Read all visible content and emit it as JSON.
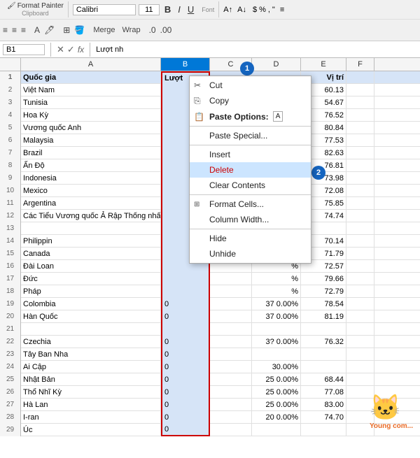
{
  "toolbar": {
    "format_painter_label": "Format Painter",
    "clipboard_label": "Clipboard",
    "font_label": "Font",
    "font_name": "Calibri",
    "font_size": "11",
    "bold": "B",
    "italic": "I",
    "underline": "U"
  },
  "formula_bar": {
    "name_box": "B1",
    "content": "Lượt nh"
  },
  "columns": {
    "a": "A",
    "b": "B",
    "c": "C",
    "d": "D",
    "e": "E",
    "f": "F"
  },
  "context_menu": {
    "cut": "Cut",
    "copy": "Copy",
    "paste_options": "Paste Options:",
    "paste_special": "Paste Special...",
    "insert": "Insert",
    "delete": "Delete",
    "clear_contents": "Clear Contents",
    "format_cells": "Format Cells...",
    "column_width": "Column Width...",
    "hide": "Hide",
    "unhide": "Unhide"
  },
  "rows": [
    {
      "num": "1",
      "a": "Quốc gia",
      "b": "Lượt",
      "c": "",
      "d": "",
      "e": "Vị trí",
      "f": ""
    },
    {
      "num": "2",
      "a": "Việt Nam",
      "b": "",
      "c": "",
      "d": "%",
      "e": "60.13",
      "f": ""
    },
    {
      "num": "3",
      "a": "Tunisia",
      "b": "",
      "c": "",
      "d": "%",
      "e": "54.67",
      "f": ""
    },
    {
      "num": "4",
      "a": "Hoa Kỳ",
      "b": "",
      "c": "",
      "d": "%",
      "e": "76.52",
      "f": ""
    },
    {
      "num": "5",
      "a": "Vương quốc Anh",
      "b": "",
      "c": "",
      "d": "%",
      "e": "80.84",
      "f": ""
    },
    {
      "num": "6",
      "a": "Malaysia",
      "b": "",
      "c": "",
      "d": "%",
      "e": "77.53",
      "f": ""
    },
    {
      "num": "7",
      "a": "Brazil",
      "b": "",
      "c": "",
      "d": "%",
      "e": "82.63",
      "f": ""
    },
    {
      "num": "8",
      "a": "Ấn Độ",
      "b": "",
      "c": "",
      "d": "%",
      "e": "76.81",
      "f": ""
    },
    {
      "num": "9",
      "a": "Indonesia",
      "b": "",
      "c": "",
      "d": "%",
      "e": "73.98",
      "f": ""
    },
    {
      "num": "10",
      "a": "Mexico",
      "b": "",
      "c": "",
      "d": "%",
      "e": "72.08",
      "f": ""
    },
    {
      "num": "11",
      "a": "Argentina",
      "b": "",
      "c": "",
      "d": "%",
      "e": "75.85",
      "f": ""
    },
    {
      "num": "12",
      "a": "Các Tiểu Vương quốc Ả Rập Thống nhất",
      "b": "",
      "c": "",
      "d": "%",
      "e": "74.74",
      "f": ""
    },
    {
      "num": "13",
      "a": "",
      "b": "",
      "c": "",
      "d": "",
      "e": "",
      "f": ""
    },
    {
      "num": "14",
      "a": "Philippin",
      "b": "",
      "c": "",
      "d": "%",
      "e": "70.14",
      "f": ""
    },
    {
      "num": "15",
      "a": "Canada",
      "b": "",
      "c": "",
      "d": "%",
      "e": "71.79",
      "f": ""
    },
    {
      "num": "16",
      "a": "Đài Loan",
      "b": "",
      "c": "",
      "d": "%",
      "e": "72.57",
      "f": ""
    },
    {
      "num": "17",
      "a": "Đức",
      "b": "",
      "c": "",
      "d": "%",
      "e": "79.66",
      "f": ""
    },
    {
      "num": "18",
      "a": "Pháp",
      "b": "",
      "c": "",
      "d": "%",
      "e": "72.79",
      "f": ""
    },
    {
      "num": "19",
      "a": "Colombia",
      "b": "0",
      "c": "",
      "d": "37  0.00%",
      "e": "78.54",
      "f": ""
    },
    {
      "num": "20",
      "a": "Hàn Quốc",
      "b": "0",
      "c": "",
      "d": "37  0.00%",
      "e": "81.19",
      "f": ""
    },
    {
      "num": "21",
      "a": "",
      "b": "",
      "c": "",
      "d": "",
      "e": "",
      "f": ""
    },
    {
      "num": "22",
      "a": "Czechia",
      "b": "0",
      "c": "",
      "d": "3?  0.00%",
      "e": "76.32",
      "f": ""
    },
    {
      "num": "23",
      "a": "Tây Ban Nha",
      "b": "0",
      "c": "",
      "d": "",
      "e": "",
      "f": ""
    },
    {
      "num": "24",
      "a": "Ai Cập",
      "b": "0",
      "c": "",
      "d": "30.00%",
      "e": "",
      "f": ""
    },
    {
      "num": "25",
      "a": "Nhật Bản",
      "b": "0",
      "c": "",
      "d": "25  0.00%",
      "e": "68.44",
      "f": ""
    },
    {
      "num": "26",
      "a": "Thổ Nhĩ Kỳ",
      "b": "0",
      "c": "",
      "d": "25  0.00%",
      "e": "77.08",
      "f": ""
    },
    {
      "num": "27",
      "a": "Hà Lan",
      "b": "0",
      "c": "",
      "d": "25  0.00%",
      "e": "83.00",
      "f": ""
    },
    {
      "num": "28",
      "a": "I-ran",
      "b": "0",
      "c": "",
      "d": "20  0.00%",
      "e": "74.70",
      "f": ""
    },
    {
      "num": "29",
      "a": "Úc",
      "b": "0",
      "c": "",
      "d": "",
      "e": "",
      "f": ""
    }
  ],
  "badges": {
    "one": "1",
    "two": "2"
  },
  "watermark": {
    "text": "Young com..."
  }
}
